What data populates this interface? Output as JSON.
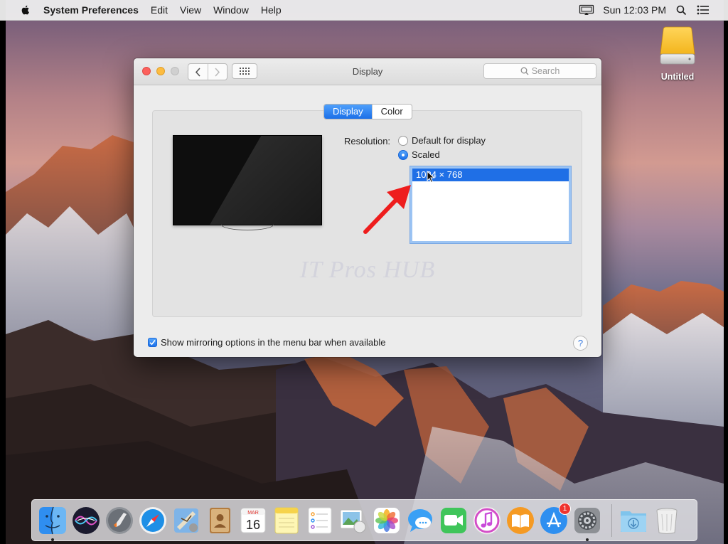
{
  "menubar": {
    "app_name": "System Preferences",
    "menus": [
      "Edit",
      "View",
      "Window",
      "Help"
    ],
    "clock": "Sun 12:03 PM"
  },
  "window": {
    "title": "Display",
    "search_placeholder": "Search",
    "tabs": [
      {
        "label": "Display",
        "selected": true
      },
      {
        "label": "Color",
        "selected": false
      }
    ],
    "resolution": {
      "label": "Resolution:",
      "options": [
        {
          "label": "Default for display",
          "selected": false
        },
        {
          "label": "Scaled",
          "selected": true
        }
      ],
      "scaled_list": [
        "1024 × 768"
      ]
    },
    "mirroring_checkbox": {
      "label": "Show mirroring options in the menu bar when available",
      "checked": true
    },
    "help": "?"
  },
  "watermark": "IT Pros HUB",
  "desktop": {
    "drive_label": "Untitled"
  },
  "dock": {
    "calendar_month": "MAR",
    "calendar_day": "16",
    "app_store_badge": "1",
    "items": [
      "finder-icon",
      "siri-icon",
      "launchpad-icon",
      "safari-icon",
      "mail-icon",
      "contacts-icon",
      "calendar-icon",
      "notes-icon",
      "reminders-icon",
      "photo-booth-icon",
      "photos-icon",
      "messages-icon",
      "facetime-icon",
      "itunes-icon",
      "ibooks-icon",
      "app-store-icon",
      "system-preferences-icon",
      "downloads-icon",
      "trash-icon"
    ]
  },
  "colors": {
    "accent": "#1f6fe6",
    "close": "#fc605c",
    "minimize": "#fdbc40",
    "arrow": "#ee1d1d"
  }
}
